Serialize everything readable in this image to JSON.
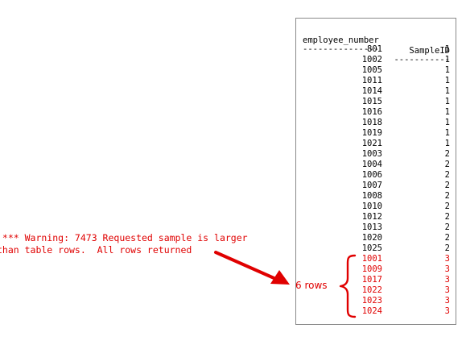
{
  "result": {
    "headers": {
      "employee_number": "employee_number",
      "sample_id": "SampleID"
    },
    "separators": {
      "col1": "---------------",
      "col2": "-----------"
    },
    "rows": [
      {
        "employee_number": "801",
        "sample_id": "1"
      },
      {
        "employee_number": "1002",
        "sample_id": "1"
      },
      {
        "employee_number": "1005",
        "sample_id": "1"
      },
      {
        "employee_number": "1011",
        "sample_id": "1"
      },
      {
        "employee_number": "1014",
        "sample_id": "1"
      },
      {
        "employee_number": "1015",
        "sample_id": "1"
      },
      {
        "employee_number": "1016",
        "sample_id": "1"
      },
      {
        "employee_number": "1018",
        "sample_id": "1"
      },
      {
        "employee_number": "1019",
        "sample_id": "1"
      },
      {
        "employee_number": "1021",
        "sample_id": "1"
      },
      {
        "employee_number": "1003",
        "sample_id": "2"
      },
      {
        "employee_number": "1004",
        "sample_id": "2"
      },
      {
        "employee_number": "1006",
        "sample_id": "2"
      },
      {
        "employee_number": "1007",
        "sample_id": "2"
      },
      {
        "employee_number": "1008",
        "sample_id": "2"
      },
      {
        "employee_number": "1010",
        "sample_id": "2"
      },
      {
        "employee_number": "1012",
        "sample_id": "2"
      },
      {
        "employee_number": "1013",
        "sample_id": "2"
      },
      {
        "employee_number": "1020",
        "sample_id": "2"
      },
      {
        "employee_number": "1025",
        "sample_id": "2"
      },
      {
        "employee_number": "1001",
        "sample_id": "3",
        "highlighted": true
      },
      {
        "employee_number": "1009",
        "sample_id": "3",
        "highlighted": true
      },
      {
        "employee_number": "1017",
        "sample_id": "3",
        "highlighted": true
      },
      {
        "employee_number": "1022",
        "sample_id": "3",
        "highlighted": true
      },
      {
        "employee_number": "1023",
        "sample_id": "3",
        "highlighted": true
      },
      {
        "employee_number": "1024",
        "sample_id": "3",
        "highlighted": true
      }
    ]
  },
  "annotation": {
    "warning_line1": " *** Warning: 7473 Requested sample is larger",
    "warning_line2": "than table rows.  All rows returned",
    "rows_label": "6 rows",
    "color": "#e00000",
    "icons": [
      "arrow-icon",
      "curly-brace-icon"
    ]
  }
}
